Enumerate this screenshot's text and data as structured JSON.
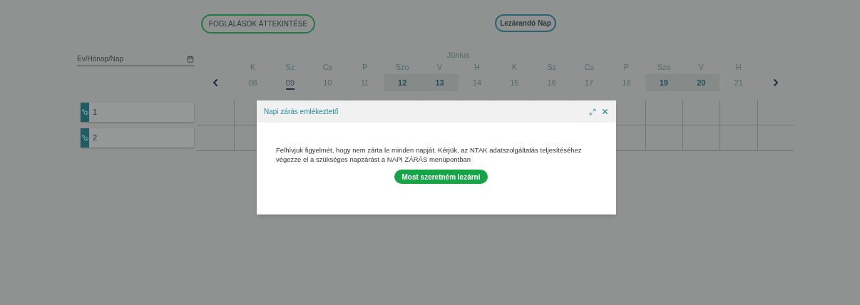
{
  "toolbar": {
    "overview_button": "FOGLALÁSOK ÁTTEKINTÉSE",
    "closing_day_button": "Lezárandó Nap"
  },
  "date_field": {
    "placeholder": "Év/Hónap/Nap"
  },
  "calendar": {
    "month": "Június",
    "days": [
      {
        "weekday": "K",
        "date": "08",
        "weekend": false,
        "selected": false
      },
      {
        "weekday": "Sz",
        "date": "09",
        "weekend": false,
        "selected": true
      },
      {
        "weekday": "Cs",
        "date": "10",
        "weekend": false,
        "selected": false
      },
      {
        "weekday": "P",
        "date": "11",
        "weekend": false,
        "selected": false
      },
      {
        "weekday": "Szo",
        "date": "12",
        "weekend": true,
        "selected": false
      },
      {
        "weekday": "V",
        "date": "13",
        "weekend": true,
        "selected": false
      },
      {
        "weekday": "H",
        "date": "14",
        "weekend": false,
        "selected": false
      },
      {
        "weekday": "K",
        "date": "15",
        "weekend": false,
        "selected": false
      },
      {
        "weekday": "Sz",
        "date": "16",
        "weekend": false,
        "selected": false
      },
      {
        "weekday": "Cs",
        "date": "17",
        "weekend": false,
        "selected": false
      },
      {
        "weekday": "P",
        "date": "18",
        "weekend": false,
        "selected": false
      },
      {
        "weekday": "Szo",
        "date": "19",
        "weekend": true,
        "selected": false
      },
      {
        "weekday": "V",
        "date": "20",
        "weekend": true,
        "selected": false
      },
      {
        "weekday": "H",
        "date": "21",
        "weekend": false,
        "selected": false
      }
    ]
  },
  "rooms": [
    {
      "name": "1"
    },
    {
      "name": "2"
    }
  ],
  "dialog": {
    "title": "Napi zárás emlékeztető",
    "message": "Felhívjuk figyelmét, hogy nem zárta le minden napját. Kérjük, az NTAK adatszolgáltatás teljesítéséhez végezze el a szükséges napzárást a NAPI ZÁRÁS menüpontban",
    "button": "Most szeretném lezárni"
  }
}
